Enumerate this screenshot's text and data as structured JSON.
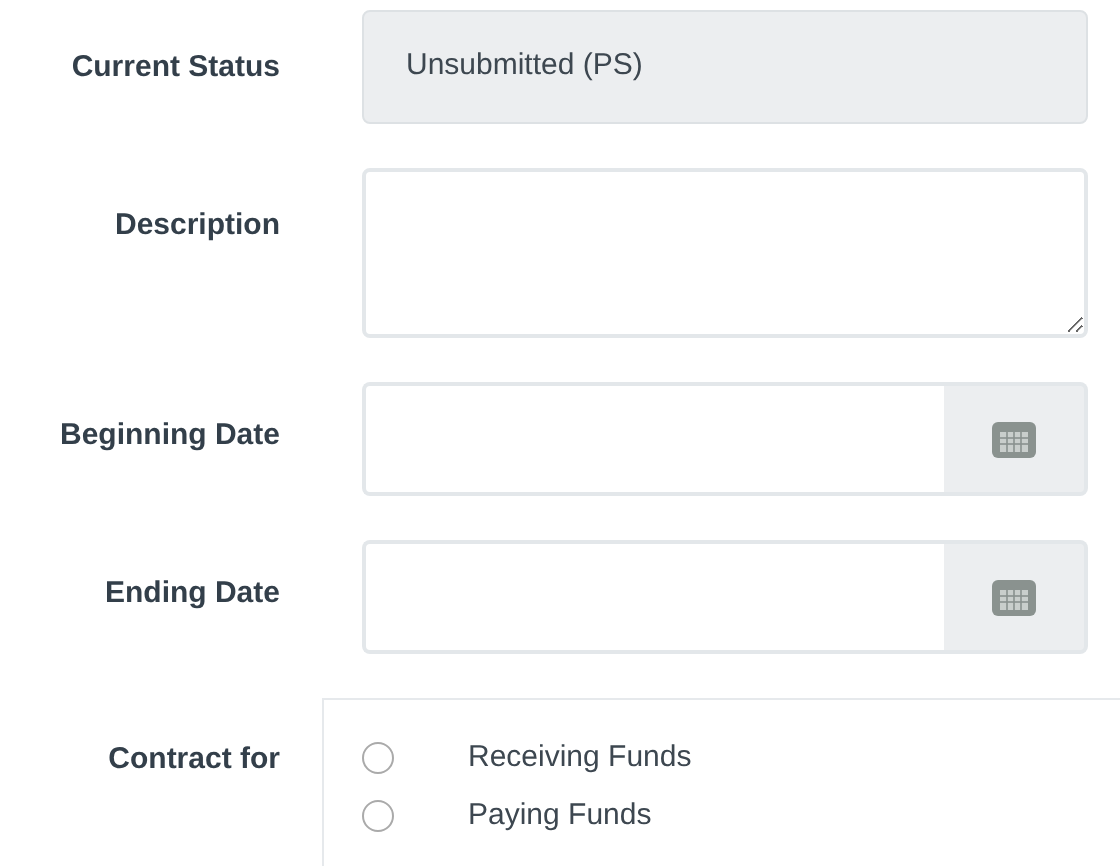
{
  "fields": [
    {
      "kind": "readonly",
      "label": "Current Status",
      "value": "Unsubmitted (PS)"
    },
    {
      "kind": "textarea",
      "label": "Description"
    },
    {
      "kind": "date",
      "label": "Beginning Date"
    },
    {
      "kind": "date",
      "label": "Ending Date"
    },
    {
      "kind": "radio",
      "label": "Contract for",
      "options": [
        {
          "label": "Receiving Funds",
          "selected": false
        },
        {
          "label": "Paying Funds",
          "selected": false
        }
      ]
    }
  ]
}
